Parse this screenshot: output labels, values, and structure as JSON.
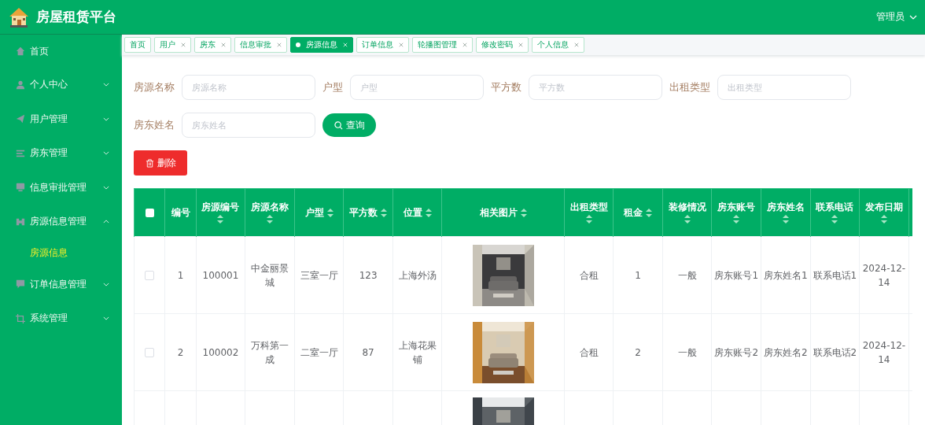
{
  "header": {
    "title": "房屋租赁平台",
    "user": "管理员"
  },
  "sidebar": {
    "items": [
      {
        "label": "首页",
        "kind": "link"
      },
      {
        "label": "个人中心",
        "kind": "menu",
        "expanded": false
      },
      {
        "label": "用户管理",
        "kind": "menu",
        "expanded": false
      },
      {
        "label": "房东管理",
        "kind": "menu",
        "expanded": false
      },
      {
        "label": "信息审批管理",
        "kind": "menu",
        "expanded": false
      },
      {
        "label": "房源信息管理",
        "kind": "menu",
        "expanded": true,
        "children": [
          {
            "label": "房源信息",
            "selected": true
          }
        ]
      },
      {
        "label": "订单信息管理",
        "kind": "menu",
        "expanded": false
      },
      {
        "label": "系统管理",
        "kind": "menu",
        "expanded": false
      }
    ]
  },
  "tabs": [
    {
      "label": "首页",
      "closable": false,
      "selected": false
    },
    {
      "label": "用户",
      "closable": true,
      "selected": false
    },
    {
      "label": "房东",
      "closable": true,
      "selected": false
    },
    {
      "label": "信息审批",
      "closable": true,
      "selected": false
    },
    {
      "label": "房源信息",
      "closable": true,
      "selected": true
    },
    {
      "label": "订单信息",
      "closable": true,
      "selected": false
    },
    {
      "label": "轮播图管理",
      "closable": true,
      "selected": false
    },
    {
      "label": "修改密码",
      "closable": true,
      "selected": false
    },
    {
      "label": "个人信息",
      "closable": true,
      "selected": false
    }
  ],
  "filters": [
    {
      "label": "房源名称",
      "placeholder": "房源名称"
    },
    {
      "label": "户型",
      "placeholder": "户型"
    },
    {
      "label": "平方数",
      "placeholder": "平方数"
    },
    {
      "label": "出租类型",
      "placeholder": "出租类型"
    },
    {
      "label": "房东姓名",
      "placeholder": "房东姓名"
    }
  ],
  "search_button": "查询",
  "delete_button": "删除",
  "table": {
    "columns": [
      {
        "kind": "check",
        "checked": false
      },
      {
        "kind": "text",
        "label": "编号",
        "sortable": false
      },
      {
        "kind": "text",
        "label": "房源编号",
        "sortable": true
      },
      {
        "kind": "text",
        "label": "房源名称",
        "sortable": true
      },
      {
        "kind": "text",
        "label": "户型",
        "sortable": true
      },
      {
        "kind": "text",
        "label": "平方数",
        "sortable": true
      },
      {
        "kind": "text",
        "label": "位置",
        "sortable": true
      },
      {
        "kind": "picture",
        "label": "相关图片",
        "sortable": true
      },
      {
        "kind": "text",
        "label": "出租类型",
        "sortable": true
      },
      {
        "kind": "text",
        "label": "租金",
        "sortable": true
      },
      {
        "kind": "text",
        "label": "装修情况",
        "sortable": true
      },
      {
        "kind": "text",
        "label": "房东账号",
        "sortable": true
      },
      {
        "kind": "text",
        "label": "房东姓名",
        "sortable": true
      },
      {
        "kind": "text",
        "label": "联系电话",
        "sortable": true
      },
      {
        "kind": "text",
        "label": "发布日期",
        "sortable": true
      },
      {
        "kind": "cut"
      }
    ],
    "rows": [
      {
        "kind": "full",
        "checked": false,
        "cells": [
          "1",
          "100001",
          "中金丽景城",
          "三室一厅",
          "123",
          "上海外汤",
          "合租",
          "1",
          "一般",
          "房东账号1",
          "房东姓名1",
          "联系电话1",
          "2024-12-14"
        ]
      },
      {
        "kind": "full",
        "checked": false,
        "cells": [
          "2",
          "100002",
          "万科第一成",
          "二室一厅",
          "87",
          "上海花果铺",
          "合租",
          "2",
          "一般",
          "房东账号2",
          "房东姓名2",
          "联系电话2",
          "2024-12-14"
        ]
      },
      {
        "kind": "cut"
      }
    ]
  }
}
